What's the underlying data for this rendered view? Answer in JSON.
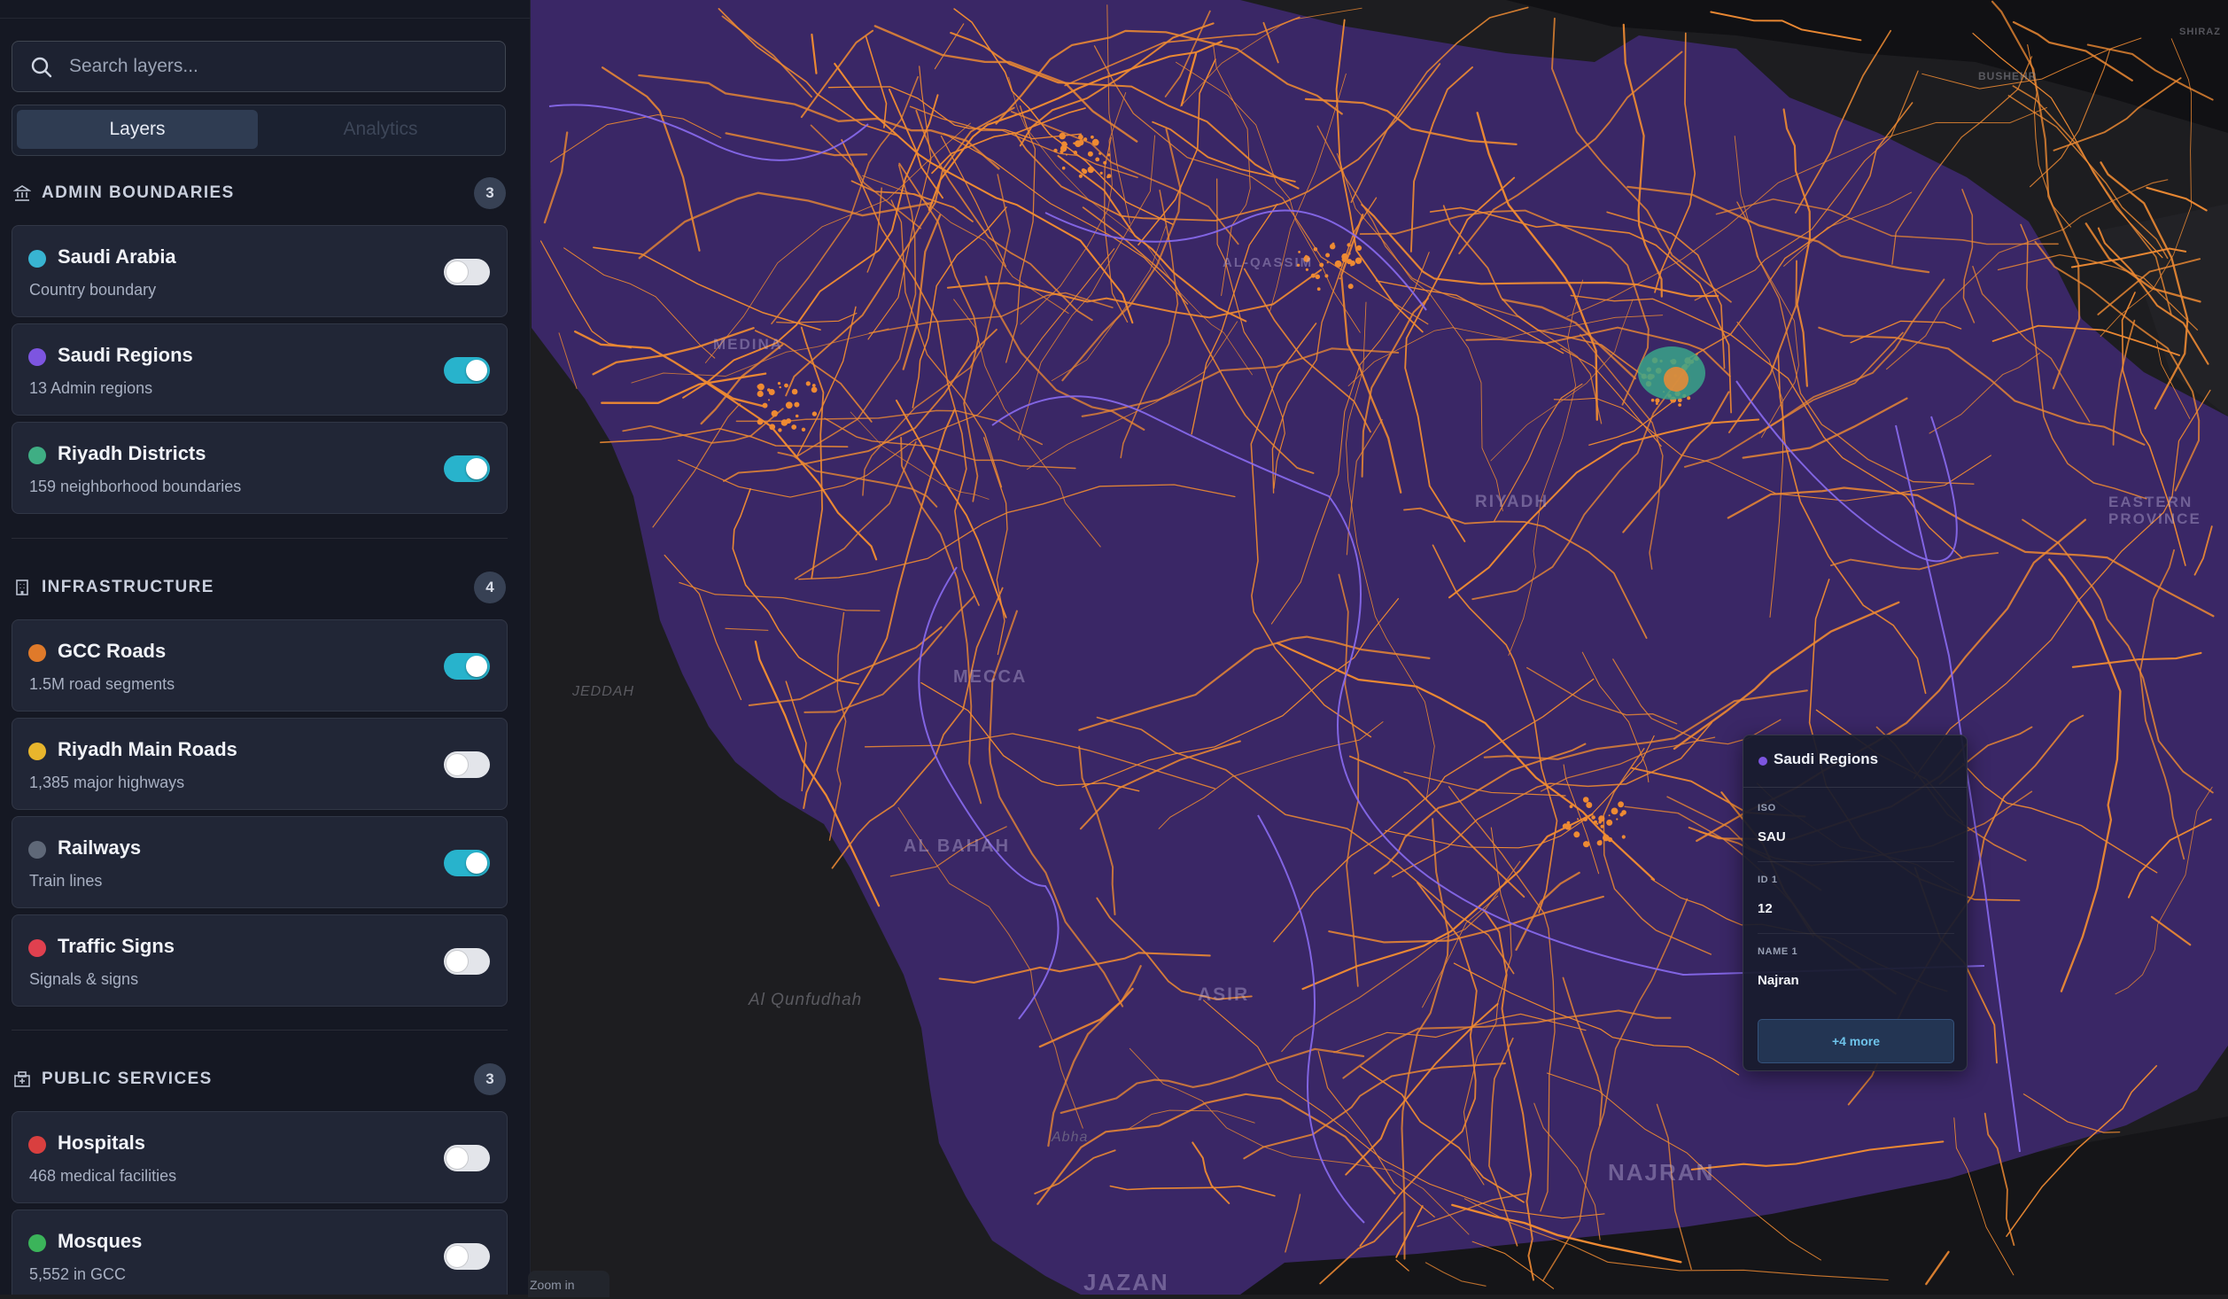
{
  "search": {
    "placeholder": "Search layers..."
  },
  "tabs": [
    {
      "label": "Layers",
      "active": true
    },
    {
      "label": "Analytics",
      "active": false
    }
  ],
  "sections": [
    {
      "title": "ADMIN BOUNDARIES",
      "icon": "landmark-icon",
      "count": "3",
      "layers": [
        {
          "name": "Saudi Arabia",
          "desc": "Country boundary",
          "color": "#38b4d2",
          "enabled": false
        },
        {
          "name": "Saudi Regions",
          "desc": "13 Admin regions",
          "color": "#7d55e0",
          "enabled": true
        },
        {
          "name": "Riyadh Districts",
          "desc": "159 neighborhood boundaries",
          "color": "#3fae84",
          "enabled": true
        }
      ]
    },
    {
      "title": "INFRASTRUCTURE",
      "icon": "building-icon",
      "count": "4",
      "layers": [
        {
          "name": "GCC Roads",
          "desc": "1.5M road segments",
          "color": "#e07a2a",
          "enabled": true
        },
        {
          "name": "Riyadh Main Roads",
          "desc": "1,385 major highways",
          "color": "#e8b52c",
          "enabled": false
        },
        {
          "name": "Railways",
          "desc": "Train lines",
          "color": "#5f6878",
          "enabled": true
        },
        {
          "name": "Traffic Signs",
          "desc": "Signals & signs",
          "color": "#e0404f",
          "enabled": false
        }
      ]
    },
    {
      "title": "PUBLIC SERVICES",
      "icon": "hospital-building-icon",
      "count": "3",
      "layers": [
        {
          "name": "Hospitals",
          "desc": "468 medical facilities",
          "color": "#d93f3f",
          "enabled": false
        },
        {
          "name": "Mosques",
          "desc": "5,552 in GCC",
          "color": "#3bb45a",
          "enabled": false
        }
      ]
    }
  ],
  "bottom_note": "Zoom in",
  "popup": {
    "title": "Saudi Regions",
    "dot_color": "#7d55e0",
    "rows": [
      {
        "key": "ISO",
        "value": "SAU"
      },
      {
        "key": "ID 1",
        "value": "12"
      },
      {
        "key": "NAME 1",
        "value": "Najran"
      }
    ],
    "more_label": "+4 more"
  },
  "map": {
    "land_color": "#3a2766",
    "road_color": "#ee8a33",
    "background_color": "#1d1d20",
    "region_labels": [
      "MEDINA",
      "RIYADH",
      "MECCA",
      "AL BAHAH",
      "ASIR",
      "NAJRAN",
      "JAZAN",
      "AL-QASSIM",
      "EASTERN PROVINCE"
    ],
    "city_labels": [
      "JEDDAH",
      "Al Qunfudhah",
      "Abha",
      "BUSHEHR",
      "SHIRAZ"
    ]
  }
}
